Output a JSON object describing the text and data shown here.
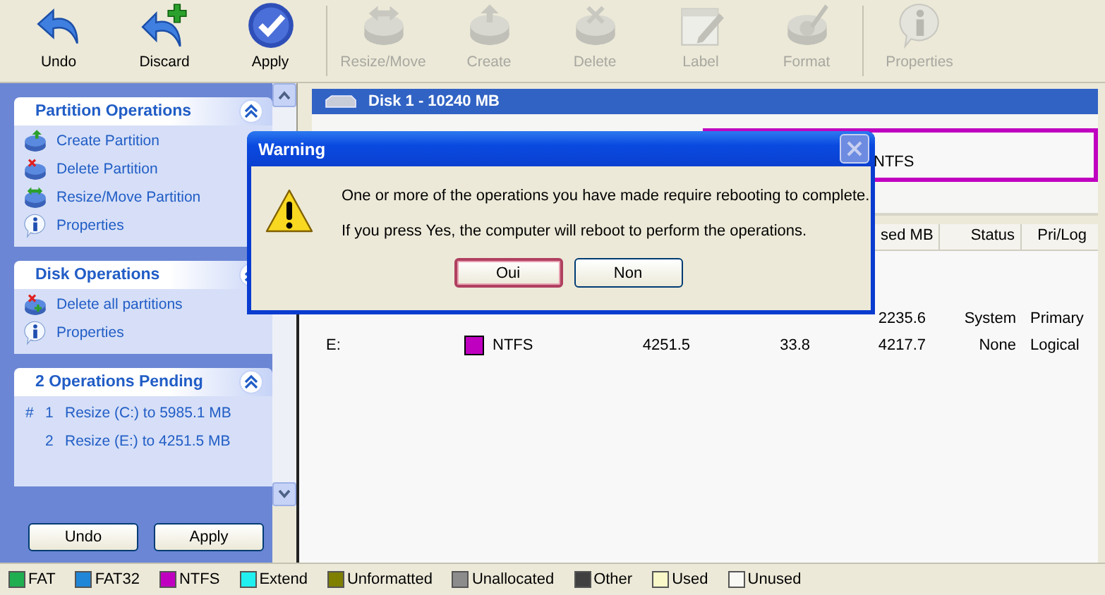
{
  "toolbar": [
    {
      "label": "Undo",
      "kind": "undo",
      "disabled": false
    },
    {
      "label": "Discard",
      "kind": "discard",
      "disabled": false
    },
    {
      "label": "Apply",
      "kind": "apply",
      "disabled": false
    },
    {
      "label": "Resize/Move",
      "kind": "resize",
      "disabled": true
    },
    {
      "label": "Create",
      "kind": "create",
      "disabled": true
    },
    {
      "label": "Delete",
      "kind": "delete",
      "disabled": true
    },
    {
      "label": "Label",
      "kind": "label",
      "disabled": true
    },
    {
      "label": "Format",
      "kind": "format",
      "disabled": true
    },
    {
      "label": "Properties",
      "kind": "properties",
      "disabled": true
    }
  ],
  "sidebar": {
    "sections": [
      {
        "title": "Partition Operations",
        "items": [
          {
            "label": "Create Partition",
            "kind": "create"
          },
          {
            "label": "Delete Partition",
            "kind": "delete"
          },
          {
            "label": "Resize/Move Partition",
            "kind": "resize"
          },
          {
            "label": "Properties",
            "kind": "properties"
          }
        ]
      },
      {
        "title": "Disk Operations",
        "items": [
          {
            "label": "Delete all partitions",
            "kind": "delete-all"
          },
          {
            "label": "Properties",
            "kind": "properties"
          }
        ]
      },
      {
        "title": "2 Operations Pending",
        "items": [
          {
            "marker": "#",
            "number": "1",
            "label": "Resize (C:) to 5985.1 MB",
            "kind": "pending"
          },
          {
            "number": "2",
            "label": "Resize (E:) to 4251.5 MB",
            "kind": "pending"
          }
        ]
      }
    ],
    "buttons": [
      "Undo",
      "Apply"
    ]
  },
  "disk": {
    "title": "Disk 1 - 10240 MB",
    "partition": {
      "label": "NTFS",
      "color": "#c000c0"
    }
  },
  "table": {
    "columns": [
      "sed MB",
      "Status",
      "Pri/Log"
    ],
    "rows": [
      {
        "unused_mb": "2235.6",
        "status": "System",
        "pri_log": "Primary"
      },
      {
        "partition": "E:",
        "color": "#c000c0",
        "file_system": "NTFS",
        "column_4": "4251.5",
        "column_5": "33.8",
        "unused_mb": "4217.7",
        "status": "None",
        "pri_log": "Logical"
      }
    ]
  },
  "dialog": {
    "title": "Warning",
    "messages": [
      "One or more of the operations you have made require rebooting to complete.",
      "If you press Yes, the computer will reboot to perform the operations."
    ],
    "buttons": [
      {
        "label": "Oui",
        "selected": true
      },
      {
        "label": "Non",
        "selected": false
      }
    ]
  },
  "legend": [
    {
      "label": "FAT",
      "color": "#1fae50"
    },
    {
      "label": "FAT32",
      "color": "#1f86d8"
    },
    {
      "label": "NTFS",
      "color": "#c000c0"
    },
    {
      "label": "Extend",
      "color": "#20f0f0"
    },
    {
      "label": "Unformatted",
      "color": "#7f7f00"
    },
    {
      "label": "Unallocated",
      "color": "#8c8c8c"
    },
    {
      "label": "Other",
      "color": "#404040"
    },
    {
      "label": "Used",
      "color": "#f8f8c8"
    },
    {
      "label": "Unused",
      "color": "#f8f8f4"
    }
  ]
}
